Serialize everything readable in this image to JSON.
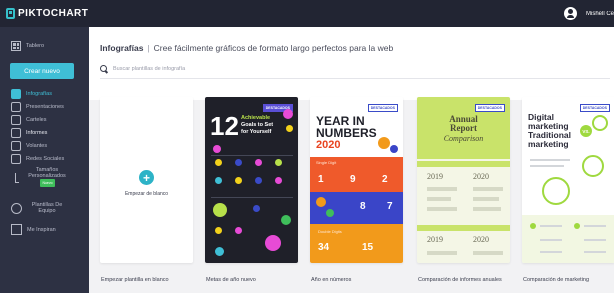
{
  "app": {
    "name": "PIKTOCHART",
    "user_name": "Mishell Cez"
  },
  "sidebar": {
    "tablero": "Tablero",
    "create_button": "Crear nuevo",
    "items": [
      {
        "label": "Infografías",
        "active": true
      },
      {
        "label": "Presentaciones"
      },
      {
        "label": "Carteles"
      },
      {
        "label": "Informes"
      },
      {
        "label": "Volantes"
      },
      {
        "label": "Redes Sociales"
      }
    ],
    "custom_sizes": "Tamaños Personalizados",
    "custom_badge": "Nuevo",
    "team_templates": "Plantillas De Equipo",
    "inspiration": "Me Inspiran"
  },
  "header": {
    "title": "Infografías",
    "separator": "|",
    "subtitle": "Cree fácilmente gráficos de formato largo perfectos para la web"
  },
  "search": {
    "placeholder": "Buscar plantillas de infografía"
  },
  "cards": [
    {
      "caption": "Empezar plantilla en blanco",
      "label": "Empezar de blanco"
    },
    {
      "caption": "Metas de año nuevo",
      "tag": "DESTACADOS",
      "big": "12",
      "line1": "Achievable",
      "line2": "Goals to Set",
      "line3": "for Yourself"
    },
    {
      "caption": "Año en números",
      "tag": "DESTACADOS",
      "line1": "YEAR IN",
      "line2": "NUMBERS",
      "year": "2020",
      "label1": "Single Digit",
      "n1": "1",
      "n2": "9",
      "n3": "2",
      "n4": "8",
      "n5": "7",
      "label2": "Double Digits",
      "n6": "34",
      "n7": "15"
    },
    {
      "caption": "Comparación de informes anuales",
      "tag": "DESTACADOS",
      "line1": "Annual",
      "line2": "Report",
      "line3": "Comparison",
      "year_a": "2019",
      "year_b": "2020"
    },
    {
      "caption": "Comparación de marketing",
      "tag": "DESTACADOS",
      "line1": "Digital",
      "line2": "marketing",
      "line3": "Traditional",
      "line4": "marketing",
      "vs": "VS."
    }
  ]
}
